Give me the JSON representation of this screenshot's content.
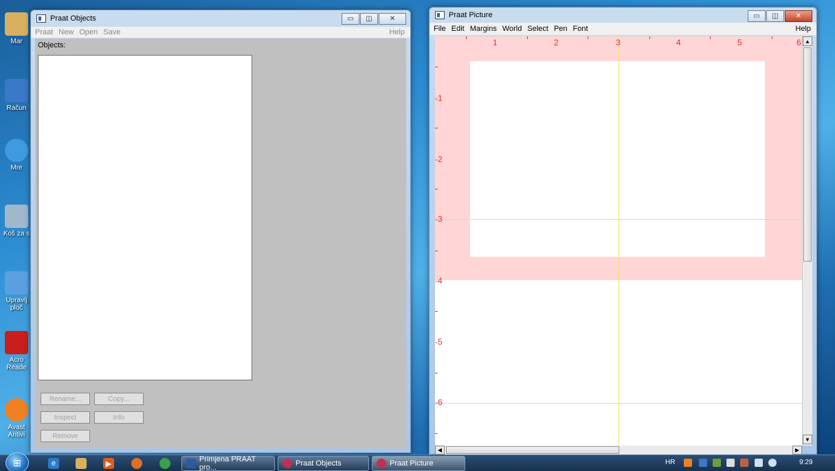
{
  "desktop": {
    "icons": [
      {
        "label": "Mar",
        "color": "#d8b060"
      },
      {
        "label": "Račun",
        "color": "#3a78c8"
      },
      {
        "label": "Mre",
        "color": "#3f9ae0"
      },
      {
        "label": "Koš za s",
        "color": "#9fb8cc"
      },
      {
        "label": "Upravlj ploč",
        "color": "#5aa0e0"
      },
      {
        "label": "Acro Reade",
        "color": "#c81e1e"
      },
      {
        "label": "Avast Antivi",
        "color": "#f08020"
      }
    ]
  },
  "objects_window": {
    "title": "Praat Objects",
    "menu": [
      "Praat",
      "New",
      "Open",
      "Save"
    ],
    "help": "Help",
    "caption": "Objects:",
    "buttons": {
      "rename": "Rename...",
      "copy": "Copy...",
      "inspect": "Inspect",
      "info": "Info",
      "remove": "Remove"
    },
    "caption_buttons": {
      "minimize": "▭",
      "maximize": "◫",
      "close": "✕"
    }
  },
  "picture_window": {
    "title": "Praat Picture",
    "menu": [
      "File",
      "Edit",
      "Margins",
      "World",
      "Select",
      "Pen",
      "Font"
    ],
    "help": "Help",
    "x_labels": [
      "1",
      "2",
      "3",
      "4",
      "5",
      "6"
    ],
    "y_labels": [
      "1",
      "2",
      "3",
      "4",
      "5",
      "6"
    ],
    "colors": {
      "margin": "#ffd5d5",
      "ruler": "#e03030",
      "guide": "#f2e060"
    },
    "caption_buttons": {
      "minimize": "▭",
      "maximize": "◫",
      "close": "✕"
    }
  },
  "taskbar": {
    "tasks": [
      {
        "label": "Primjena PRAAT pro...",
        "active": false
      },
      {
        "label": "Praat Objects",
        "active": false
      },
      {
        "label": "Praat Picture",
        "active": true
      }
    ],
    "language": "HR",
    "clock": "9:29"
  }
}
